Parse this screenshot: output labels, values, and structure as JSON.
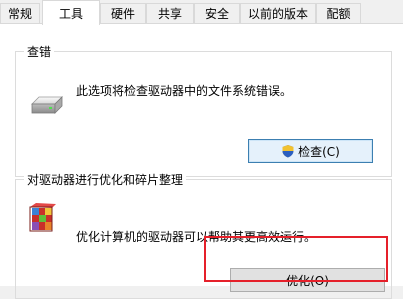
{
  "tabs": [
    {
      "label": "常规",
      "selected": false
    },
    {
      "label": "工具",
      "selected": true
    },
    {
      "label": "硬件",
      "selected": false
    },
    {
      "label": "共享",
      "selected": false
    },
    {
      "label": "安全",
      "selected": false
    },
    {
      "label": "以前的版本",
      "selected": false
    },
    {
      "label": "配额",
      "selected": false
    }
  ],
  "error_check": {
    "title": "查错",
    "description": "此选项将检查驱动器中的文件系统错误。",
    "button_label": "检查(C)",
    "icon": "drive-icon",
    "button_icon": "uac-shield-icon"
  },
  "optimize": {
    "title": "对驱动器进行优化和碎片整理",
    "description": "优化计算机的驱动器可以帮助其更高效运行。",
    "button_label": "优化(O)",
    "icon": "defrag-icon",
    "highlight_color": "#e5202a"
  },
  "colors": {
    "dialog_bg": "#f0f0f0",
    "panel_bg": "#ffffff",
    "focus_border": "#3c7fb1",
    "highlight": "#e5202a"
  }
}
